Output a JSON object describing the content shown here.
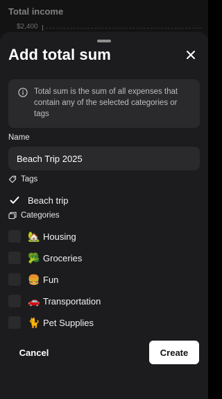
{
  "background": {
    "title": "Total income",
    "axis_label": "$2,400"
  },
  "sheet": {
    "title": "Add total sum",
    "close_icon": "close-icon",
    "info": {
      "icon": "info-circle-icon",
      "text": "Total sum is the sum of all expenses that contain any of the selected categories or tags"
    },
    "name": {
      "label": "Name",
      "value": "Beach Trip 2025"
    },
    "tags": {
      "label": "Tags",
      "icon": "tag-icon",
      "items": [
        {
          "label": "Beach trip",
          "checked": true
        }
      ]
    },
    "categories": {
      "label": "Categories",
      "icon": "categories-icon",
      "items": [
        {
          "emoji": "🏡",
          "label": "Housing",
          "checked": false
        },
        {
          "emoji": "🥦",
          "label": "Groceries",
          "checked": false
        },
        {
          "emoji": "🍔",
          "label": "Fun",
          "checked": false
        },
        {
          "emoji": "🚗",
          "label": "Transportation",
          "checked": false
        },
        {
          "emoji": "🐈",
          "label": "Pet Supplies",
          "checked": false
        }
      ]
    },
    "footer": {
      "cancel_label": "Cancel",
      "create_label": "Create"
    }
  }
}
